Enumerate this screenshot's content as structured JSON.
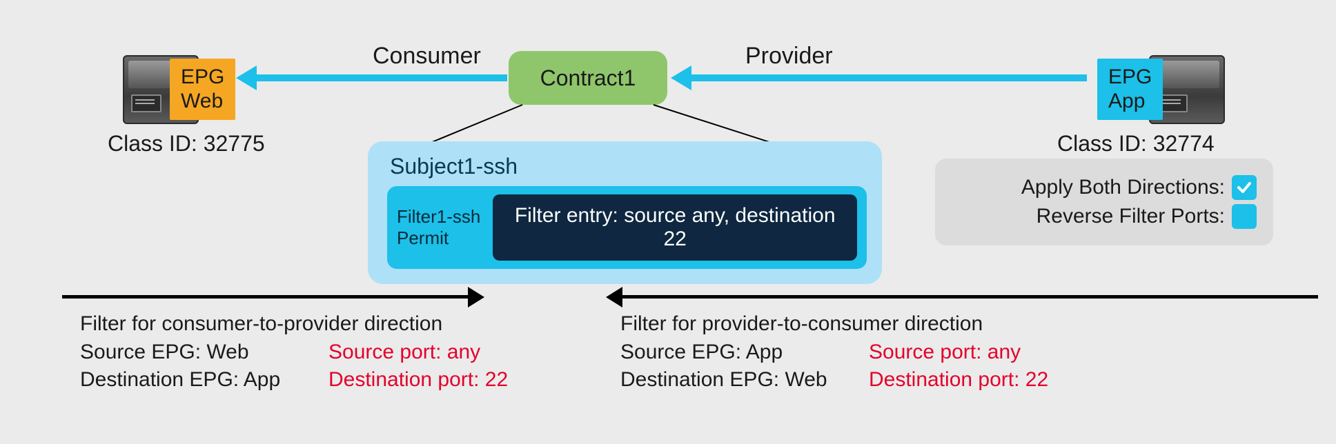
{
  "epg_web": {
    "label": "EPG\nWeb",
    "class_id": "Class ID: 32775"
  },
  "epg_app": {
    "label": "EPG\nApp",
    "class_id": "Class ID: 32774"
  },
  "contract": {
    "label": "Contract1"
  },
  "relations": {
    "consumer": "Consumer",
    "provider": "Provider"
  },
  "subject": {
    "title": "Subject1-ssh",
    "filter_name": "Filter1-ssh",
    "filter_action": "Permit",
    "filter_entry": "Filter entry: source any, destination 22"
  },
  "options": {
    "apply_both_label": "Apply Both Directions:",
    "apply_both_checked": true,
    "reverse_ports_label": "Reverse Filter Ports:",
    "reverse_ports_checked": false
  },
  "consumer_to_provider": {
    "title": "Filter for consumer-to-provider direction",
    "source_epg": "Source EPG: Web",
    "dest_epg": "Destination EPG: App",
    "source_port": "Source port: any",
    "dest_port": "Destination port: 22"
  },
  "provider_to_consumer": {
    "title": "Filter for provider-to-consumer direction",
    "source_epg": "Source EPG: App",
    "dest_epg": "Destination EPG: Web",
    "source_port": "Source port: any",
    "dest_port": "Destination port: 22"
  }
}
